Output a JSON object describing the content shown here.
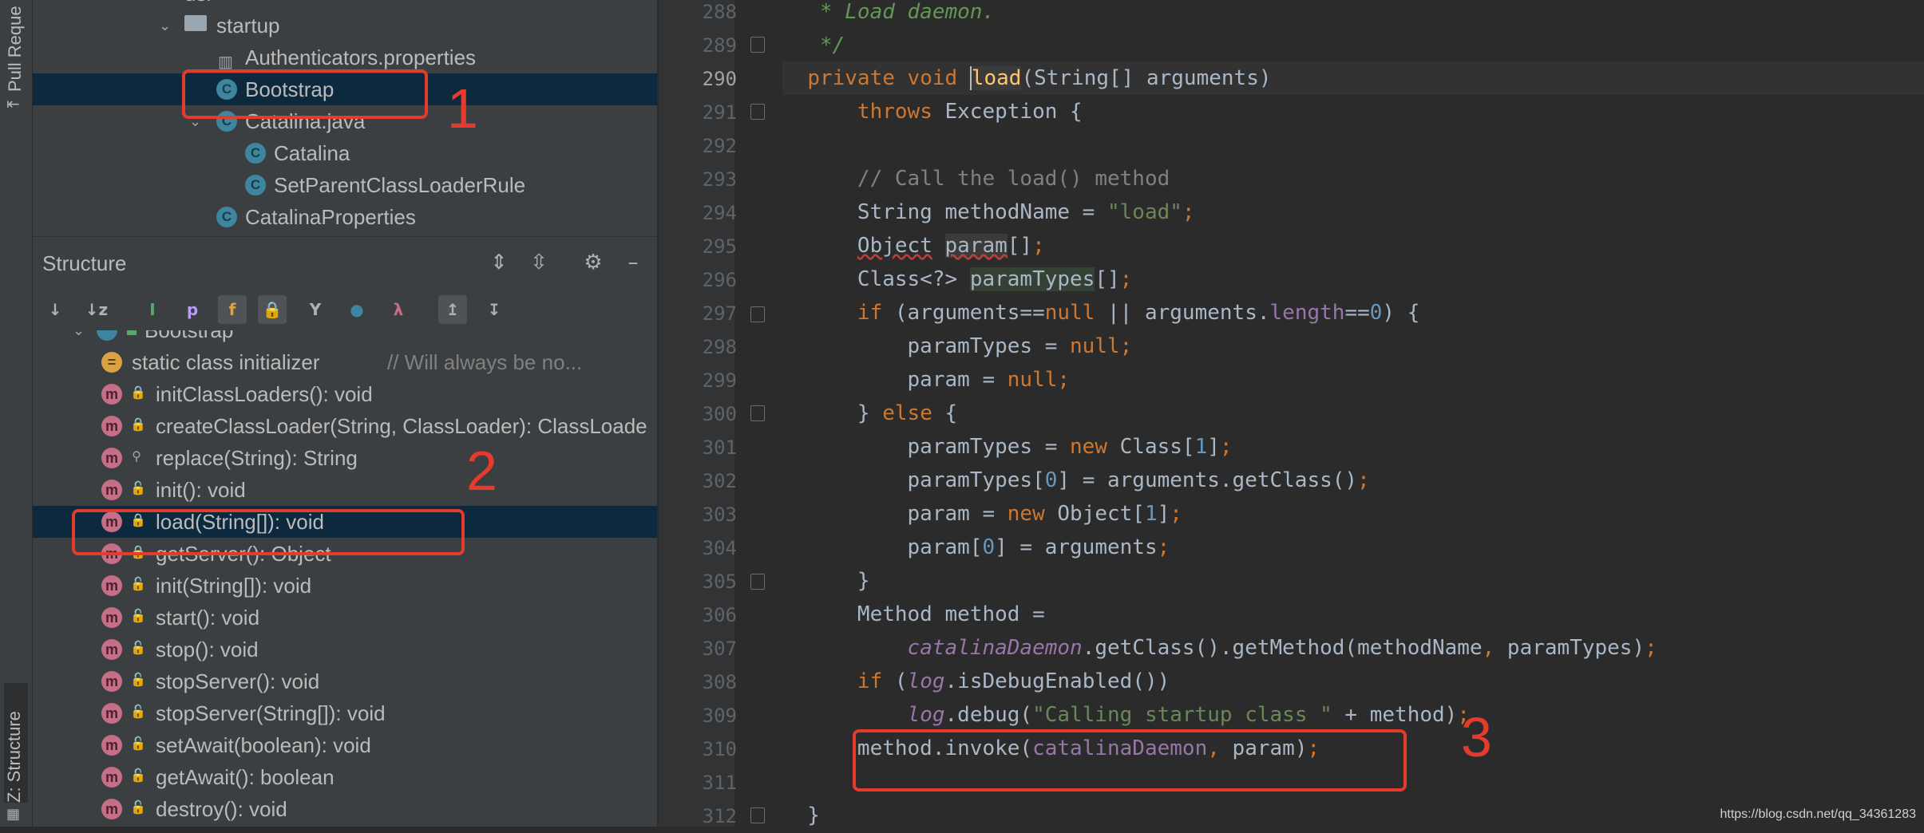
{
  "side_tabs": {
    "pull_requests": "Pull Reque",
    "structure": "Z: Structure"
  },
  "project_tree": {
    "items": [
      {
        "label": "startup",
        "type": "folder"
      },
      {
        "label": "Authenticators.properties",
        "type": "properties"
      },
      {
        "label": "Bootstrap",
        "type": "class",
        "selected": true
      },
      {
        "label": "Catalina.java",
        "type": "class"
      },
      {
        "label": "Catalina",
        "type": "class"
      },
      {
        "label": "SetParentClassLoaderRule",
        "type": "class"
      },
      {
        "label": "CatalinaProperties",
        "type": "class"
      }
    ]
  },
  "structure_panel": {
    "title": "Structure",
    "root_label": "Bootstrap",
    "members": [
      {
        "label": "static class initializer",
        "hint": "// Will always be no...",
        "icon": "static-init",
        "visibility": "none"
      },
      {
        "label": "initClassLoaders(): void",
        "icon": "m",
        "visibility": "private"
      },
      {
        "label": "createClassLoader(String, ClassLoader): ClassLoade",
        "icon": "m",
        "visibility": "private"
      },
      {
        "label": "replace(String): String",
        "icon": "m",
        "visibility": "package"
      },
      {
        "label": "init(): void",
        "icon": "m",
        "visibility": "public"
      },
      {
        "label": "load(String[]): void",
        "icon": "m",
        "visibility": "private",
        "selected": true
      },
      {
        "label": "getServer(): Object",
        "icon": "m",
        "visibility": "private"
      },
      {
        "label": "init(String[]): void",
        "icon": "m",
        "visibility": "public"
      },
      {
        "label": "start(): void",
        "icon": "m",
        "visibility": "public"
      },
      {
        "label": "stop(): void",
        "icon": "m",
        "visibility": "public"
      },
      {
        "label": "stopServer(): void",
        "icon": "m",
        "visibility": "public"
      },
      {
        "label": "stopServer(String[]): void",
        "icon": "m",
        "visibility": "public"
      },
      {
        "label": "setAwait(boolean): void",
        "icon": "m",
        "visibility": "public"
      },
      {
        "label": "getAwait(): boolean",
        "icon": "m",
        "visibility": "public"
      },
      {
        "label": "destroy(): void",
        "icon": "m",
        "visibility": "public"
      }
    ]
  },
  "editor": {
    "current_line": 290,
    "line_numbers": [
      "288",
      "289",
      "290",
      "291",
      "292",
      "293",
      "294",
      "295",
      "296",
      "297",
      "298",
      "299",
      "300",
      "301",
      "302",
      "303",
      "304",
      "305",
      "306",
      "307",
      "308",
      "309",
      "310",
      "311",
      "312"
    ]
  },
  "annotations": {
    "one": "1",
    "two": "2",
    "three": "3"
  },
  "watermark": "https://blog.csdn.net/qq_34361283",
  "colors": {
    "accent_red": "#e43b2d",
    "selection": "#0d293e",
    "panel": "#3c3f41",
    "editor_bg": "#2b2b2b"
  }
}
